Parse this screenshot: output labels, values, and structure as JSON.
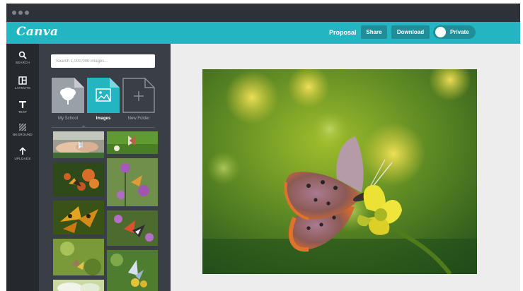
{
  "app": {
    "logo": "Canva"
  },
  "header": {
    "title": "Proposal",
    "share_label": "Share",
    "download_label": "Download",
    "privacy_label": "Private",
    "privacy_private": true
  },
  "rail": {
    "items": [
      {
        "label": "SEARCH",
        "icon": "search-icon"
      },
      {
        "label": "LAYOUTS",
        "icon": "layouts-icon"
      },
      {
        "label": "TEXT",
        "icon": "text-icon"
      },
      {
        "label": "BKGROUND",
        "icon": "background-icon"
      },
      {
        "label": "UPLOADS",
        "icon": "upload-icon"
      }
    ]
  },
  "panel": {
    "search_placeholder": "Search 1,000,000 images...",
    "folders": [
      {
        "label": "My School",
        "icon": "tree-icon"
      },
      {
        "label": "Images",
        "icon": "image-icon",
        "active": true
      },
      {
        "label": "New Folder",
        "icon": "plus-icon"
      }
    ]
  },
  "colors": {
    "accent": "#24b5c2",
    "accent_dark": "#1f8e99",
    "chrome": "#2e3137",
    "rail": "#25282d",
    "panel": "#3a3e46",
    "canvas": "#ededed"
  }
}
